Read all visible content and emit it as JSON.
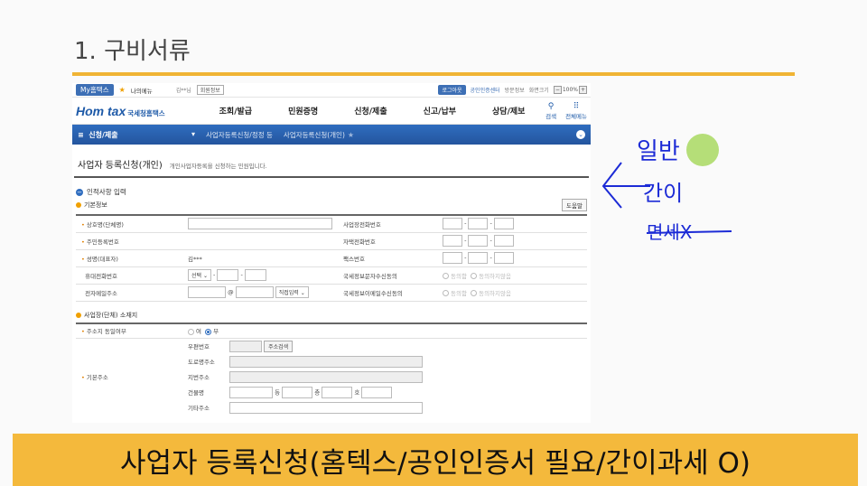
{
  "slide_title": "1. 구비서류",
  "caption": "사업자 등록신청(홈텍스/공인인증서 필요/간이과세 O)",
  "topbar": {
    "my": "My홈택스",
    "fav": "나의메뉴",
    "user": "김**님",
    "info": "회원정보",
    "login": "로그아웃",
    "cert": "공인인증센터",
    "visit": "방문정보",
    "zoom_label": "화면크기",
    "zoom": "100%"
  },
  "logo": {
    "main": "Hom tax",
    "sub": "국세청홈택스"
  },
  "menu": [
    "조회/발급",
    "민원증명",
    "신청/제출",
    "신고/납부",
    "상담/제보"
  ],
  "nav_icons": {
    "search": "검색",
    "all": "전체메뉴"
  },
  "bluebar": {
    "section": "신청/제출",
    "crumb1": "사업자등록신청/정정 등",
    "crumb2": "사업자등록신청(개인)"
  },
  "page": {
    "title": "사업자 등록신청(개인)",
    "desc": "개인사업자등록을 신청하는 민원입니다."
  },
  "sec1": "인적사항 입력",
  "basic": "기본정보",
  "help": "도움말",
  "rows": {
    "r1l": "상호명(단체명)",
    "r1r": "사업장전화번호",
    "r2l": "주민등록번호",
    "r2r": "자택전화번호",
    "r3l": "성명(대표자)",
    "r3v": "김***",
    "r3r": "팩스번호",
    "r4l": "휴대전화번호",
    "r4sel": "선택",
    "r4r": "국세정보문자수신동의",
    "r5l": "전자메일주소",
    "r5at": "@",
    "r5sel": "직접입력",
    "r5r": "국세정보이메일수신동의",
    "agree": "동의함",
    "disagree": "동의하지않음"
  },
  "sec2": "사업장(단체) 소재지",
  "addr": {
    "same": "주소지 동일여부",
    "yes": "여",
    "no": "부",
    "basic": "기본주소",
    "zip": "우편번호",
    "zipbtn": "주소검색",
    "road": "도로명주소",
    "lot": "지번주소",
    "bld": "건물명",
    "dong": "동",
    "floor": "층",
    "ho": "호",
    "etc": "기타주소"
  },
  "annotation": {
    "a1": "일반",
    "a2": "간이",
    "a3": "면세X"
  }
}
